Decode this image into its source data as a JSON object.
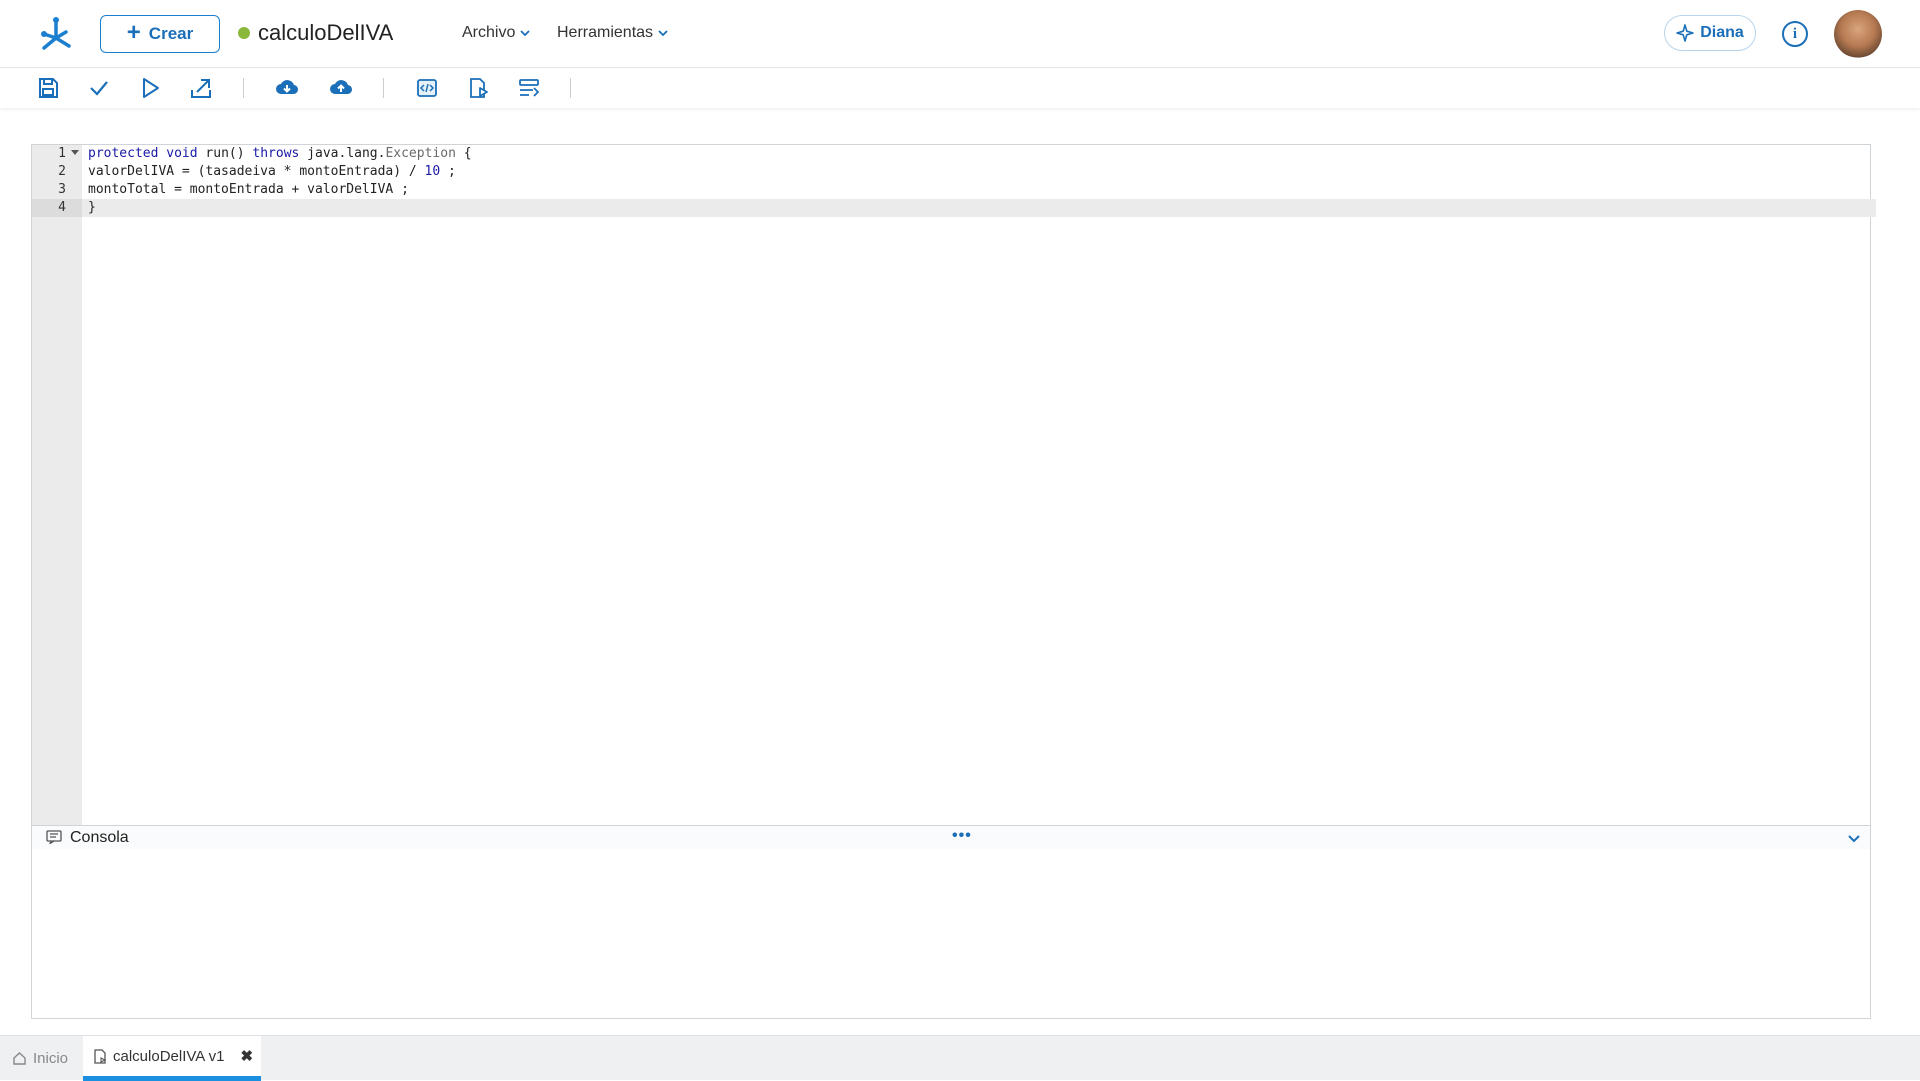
{
  "header": {
    "create_label": "Crear",
    "doc_title": "calculoDelIVA",
    "menus": [
      {
        "label": "Archivo"
      },
      {
        "label": "Herramientas"
      }
    ],
    "assistant_label": "Diana",
    "info_glyph": "i"
  },
  "toolbar": {
    "icons": [
      "save-icon",
      "check-icon",
      "run-icon",
      "export-icon",
      "download-cloud-icon",
      "upload-cloud-icon",
      "code-view-icon",
      "document-arrow-icon",
      "format-icon"
    ]
  },
  "editor": {
    "lines": [
      {
        "num": "1",
        "text": "protected void run() throws java.lang.Exception {"
      },
      {
        "num": "2",
        "text": "valorDelIVA = (tasadeiva * montoEntrada) / 10 ;"
      },
      {
        "num": "3",
        "text": "montoTotal = montoEntrada + valorDelIVA ;"
      },
      {
        "num": "4",
        "text": "}"
      }
    ]
  },
  "console": {
    "label": "Consola",
    "dots": "•••"
  },
  "tabs": {
    "home_label": "Inicio",
    "active_label": "calculoDelIVA v1",
    "close_glyph": "✖"
  },
  "colors": {
    "accent": "#1b6fb8",
    "status_ok": "#8ab83b",
    "active_tab_underline": "#1b8fe0"
  }
}
